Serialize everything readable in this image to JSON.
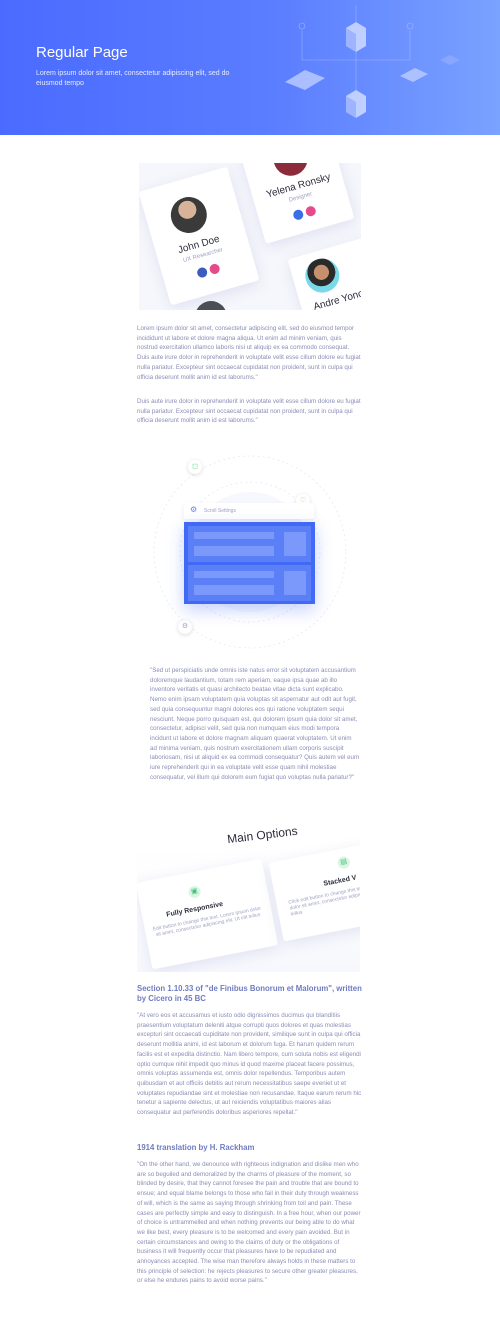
{
  "hero": {
    "title": "Regular Page",
    "subtitle": "Lorem ipsum dolor sit amet, consectetur adipiscing elit, sed do eiusmod tempo",
    "background_color": "#4a6bff"
  },
  "team": {
    "members": [
      {
        "name": "Yelena Ronsky",
        "role": "Designer",
        "icons": [
          "behance-icon",
          "dribbble-icon"
        ]
      },
      {
        "name": "John Doe",
        "role": "UX Researcher",
        "icons": [
          "facebook-icon",
          "dribbble-icon"
        ]
      },
      {
        "name": "Andre Yono"
      }
    ]
  },
  "intro": {
    "p1": "Lorem ipsum dolor sit amet, consectetur adipiscing elit, sed do eiusmod tempor incididunt ut labore et dolore magna aliqua. Ut enim ad minim veniam, quis nostrud exercitation ullamco laboris nisi ut aliquip ex ea commodo consequat. Duis aute irure dolor in reprehenderit in voluptate velit esse cillum dolore eu fugiat nulla pariatur. Excepteur sint occaecat cupidatat non proident, sunt in culpa qui officia deserunt mollit anim id est laborums.\"",
    "p2": "Duis aute irure dolor in reprehenderit in voluptate velit esse cillum dolore eu fugiat nulla pariatur. Excepteur sint occaecat cupidatat non proident, sunt in culpa qui officia deserunt mollit anim id est laborums.\""
  },
  "settings_illustration": {
    "panel_label": "Scroll Settings"
  },
  "quote": "\"Sed ut perspiciatis unde omnis iste natus error sit voluptatem accusantium doloremque laudantium, totam rem aperiam, eaque ipsa quae ab illo inventore veritatis et quasi architecto beatae vitae dicta sunt explicabo. Nemo enim ipsam voluptatem quia voluptas sit aspernatur aut odit aut fugit, sed quia consequuntur magni dolores eos qui ratione voluptatem sequi nesciunt. Neque porro quisquam est, qui dolorem ipsum quia dolor sit amet, consectetur, adipisci velit, sed quia non numquam eius modi tempora incidunt ut labore et dolore magnam aliquam quaerat voluptatem. Ut enim ad minima veniam, quis nostrum exercitationem ullam corporis suscipit laboriosam, nisi ut aliquid ex ea commodi consequatur? Quis autem vel eum iure reprehenderit qui in ea voluptate velit esse quam nihil molestiae consequatur, vel illum qui dolorem eum fugiat quo voluptas nulla pariatur?\"",
  "options": {
    "title": "Main Options",
    "cards": [
      {
        "title": "Fully Responsive",
        "text": "Edit button to change this text. Lorem ipsum dolor sit amet, consectetur adipiscing elit. Ut elit tellus"
      },
      {
        "title": "Stacked V",
        "text": "Click edit button to change this text. Lorem ipsum dolor sit amet, consectetur adipiscing elit. Ut elit tellus"
      }
    ]
  },
  "section": {
    "heading": "Section 1.10.33 of \"de Finibus Bonorum et Malorum\", written by Cicero in 45 BC",
    "p1": "\"At vero eos et accusamus et iusto odio dignissimos ducimus qui blanditiis praesentium voluptatum deleniti atque corrupti quos dolores et quas molestias excepturi sint occaecati cupiditate non provident, similique sunt in culpa qui officia deserunt mollitia animi, id est laborum et dolorum fuga. Et harum quidem rerum facilis est et expedita distinctio. Nam libero tempore, cum soluta nobis est eligendi optio cumque nihil impedit quo minus id quod maxime placeat facere possimus, omnis voluptas assumenda est, omnis dolor repellendus. Temporibus autem quibusdam et aut officiis debitis aut rerum necessitatibus saepe eveniet ut et voluptates repudiandae sint et molestiae non recusandae. Itaque earum rerum hic tenetur a sapiente delectus, ut aut reiciendis voluptatibus maiores alias consequatur aut perferendis doloribus asperiores repellat.\"",
    "subheading": "1914 translation by H. Rackham",
    "p2": "\"On the other hand, we denounce with righteous indignation and dislike men who are so beguiled and demoralized by the charms of pleasure of the moment, so blinded by desire, that they cannot foresee the pain and trouble that are bound to ensue; and equal blame belongs to those who fail in their duty through weakness of will, which is the same as saying through shrinking from toil and pain. These cases are perfectly simple and easy to distinguish. In a free hour, when our power of choice is untrammelled and when nothing prevents our being able to do what we like best, every pleasure is to be welcomed and every pain avoided. But in certain circumstances and owing to the claims of duty or the obligations of business it will frequently occur that pleasures have to be repudiated and annoyances accepted. The wise man therefore always holds in these matters to this principle of selection: he rejects pleasures to secure other greater pleasures, or else he endures pains to avoid worse pains.\""
  }
}
